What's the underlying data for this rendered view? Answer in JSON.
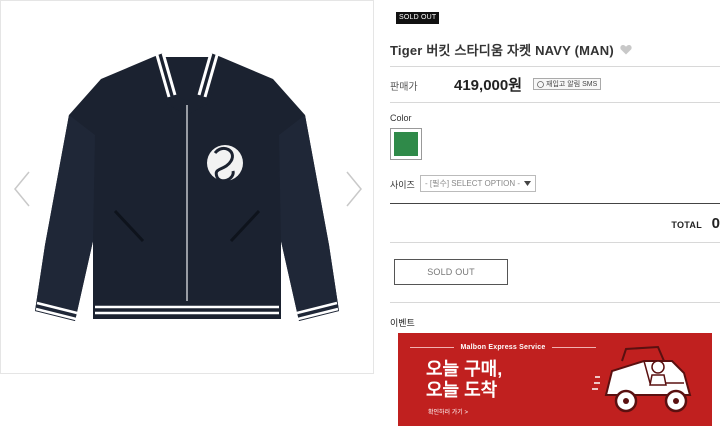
{
  "product": {
    "badge": "SOLD OUT",
    "title": "Tiger 버킷 스타디움 자켓 NAVY (MAN)"
  },
  "price": {
    "label": "판매가",
    "value": "419,000원",
    "alert_label": "재입고 알림 SMS"
  },
  "color": {
    "label": "Color",
    "options": [
      {
        "name": "green",
        "hex": "#2f8a49"
      }
    ]
  },
  "size": {
    "label": "사이즈",
    "select_value": "- [필수] SELECT OPTION -"
  },
  "total": {
    "label": "TOTAL",
    "value": "0"
  },
  "actions": {
    "soldout_button": "SOLD OUT"
  },
  "event": {
    "label": "이벤트",
    "banner": {
      "service": "Malbon Express Service",
      "headline_1": "오늘 구매,",
      "headline_2": "오늘 도착",
      "link": "확인하러 가기 >"
    }
  },
  "icons": {
    "gallery_prev": "chevron-left-icon",
    "gallery_next": "chevron-right-icon",
    "wishlist": "heart-icon",
    "select": "caret-down-icon"
  },
  "colors": {
    "banner_red": "#c0201f",
    "jacket_navy": "#1b2230"
  }
}
